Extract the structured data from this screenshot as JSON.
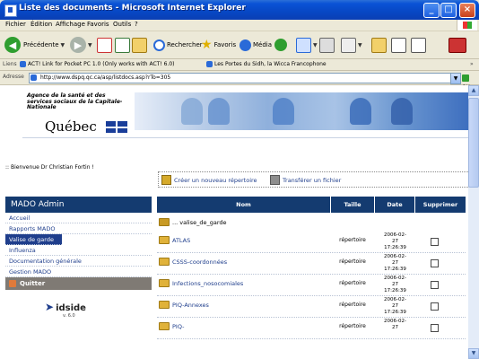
{
  "window": {
    "title": "Liste des documents - Microsoft Internet Explorer",
    "controls": [
      "_",
      "□",
      "×"
    ]
  },
  "menubar": [
    "Fichier",
    "Édition",
    "Affichage",
    "Favoris",
    "Outils",
    "?"
  ],
  "toolbar": {
    "back_label": "Précédente",
    "search_label": "Rechercher",
    "favorites_label": "Favoris",
    "media_label": "Média"
  },
  "links": {
    "label": "Liens",
    "items": [
      "ACT! Link for Pocket PC 1.0 (Only works with ACT! 6.0)",
      "Les Portes du Sidh, la Wicca Francophone"
    ]
  },
  "address": {
    "label": "Adresse",
    "url": "http://www.dspq.qc.ca/asp/listdocs.asp?rTo=305",
    "go_label": "OK"
  },
  "header": {
    "agency": "Agence de la santé et des services sociaux de la Capitale-Nationale",
    "brand": "Québec"
  },
  "welcome": ":: Bienvenue Dr Christian Fortin !",
  "actions": {
    "create_folder": "Créer un nouveau répertoire",
    "upload_file": "Transférer un fichier"
  },
  "sidebar": {
    "title": "MADO Admin",
    "items": [
      "Accueil",
      "Rapports MADO",
      "Valise de garde",
      "Influenza",
      "Documentation générale",
      "Gestion MADO"
    ],
    "active_index": 2,
    "quit_label": "Quitter",
    "logo_text": "idside",
    "version": "v. 6.0"
  },
  "table": {
    "headers": [
      "Nom",
      "Taille",
      "Date",
      "Supprimer"
    ],
    "parent": "... valise_de_garde",
    "rows": [
      {
        "name": "ATLAS",
        "size": "répertoire",
        "date": [
          "2006-02-",
          "27",
          "17:26:39"
        ]
      },
      {
        "name": "CSSS-coordonnées",
        "size": "répertoire",
        "date": [
          "2006-02-",
          "27",
          "17:26:39"
        ]
      },
      {
        "name": "Infections_nosocomiales",
        "size": "répertoire",
        "date": [
          "2006-02-",
          "27",
          "17:26:39"
        ]
      },
      {
        "name": "PIQ-Annexes",
        "size": "répertoire",
        "date": [
          "2006-02-",
          "27",
          "17:26:39"
        ]
      },
      {
        "name": "PIQ-",
        "size": "répertoire",
        "date": [
          "2006-02-",
          "27",
          ""
        ]
      }
    ]
  },
  "colors": {
    "titlebar": "#0a53d6",
    "navy": "#143b70",
    "link": "#1f3e8c",
    "quit": "#7f7a74"
  }
}
